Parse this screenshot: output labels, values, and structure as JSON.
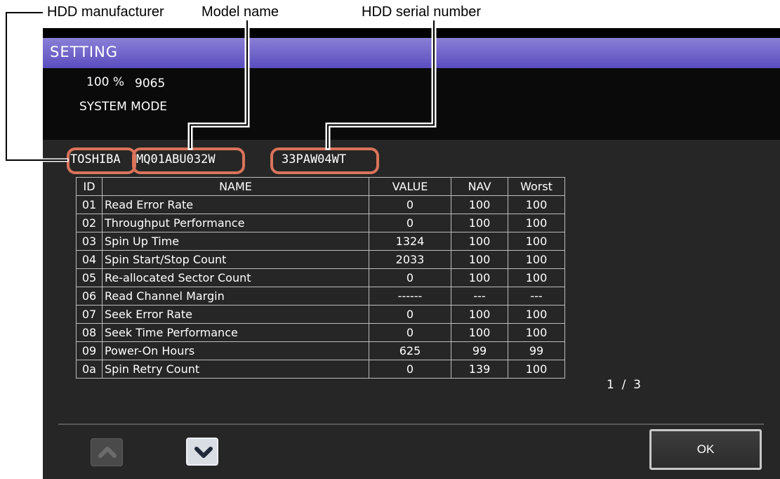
{
  "annotations": {
    "manufacturer_label": "HDD manufacturer",
    "model_label": "Model name",
    "serial_label": "HDD serial number",
    "highlight_color": "#d9735a"
  },
  "screen": {
    "title": "SETTING",
    "status": {
      "percent": "100 %",
      "code": "9065",
      "mode": "SYSTEM MODE"
    },
    "hdd": {
      "manufacturer": "TOSHIBA",
      "model": "MQ01ABU032W",
      "serial": "33PAW04WT"
    },
    "table": {
      "headers": [
        "ID",
        "NAME",
        "VALUE",
        "NAV",
        "Worst"
      ],
      "rows": [
        [
          "01",
          "Read Error Rate",
          "0",
          "100",
          "100"
        ],
        [
          "02",
          "Throughput Performance",
          "0",
          "100",
          "100"
        ],
        [
          "03",
          "Spin Up Time",
          "1324",
          "100",
          "100"
        ],
        [
          "04",
          "Spin Start/Stop Count",
          "2033",
          "100",
          "100"
        ],
        [
          "05",
          "Re-allocated Sector Count",
          "0",
          "100",
          "100"
        ],
        [
          "06",
          "Read Channel Margin",
          "------",
          "---",
          "---"
        ],
        [
          "07",
          "Seek Error Rate",
          "0",
          "100",
          "100"
        ],
        [
          "08",
          "Seek Time Performance",
          "0",
          "100",
          "100"
        ],
        [
          "09",
          "Power-On Hours",
          "625",
          "99",
          "99"
        ],
        [
          "0a",
          "Spin Retry Count",
          "0",
          "139",
          "100"
        ]
      ]
    },
    "page_indicator": "1  /  3",
    "buttons": {
      "up_icon": "chevron-up-icon",
      "down_icon": "chevron-down-icon",
      "ok_label": "OK"
    },
    "colors": {
      "title_bar": "#6a5fc9",
      "background": "#262626",
      "ok_border": "#c8c8c8"
    }
  }
}
